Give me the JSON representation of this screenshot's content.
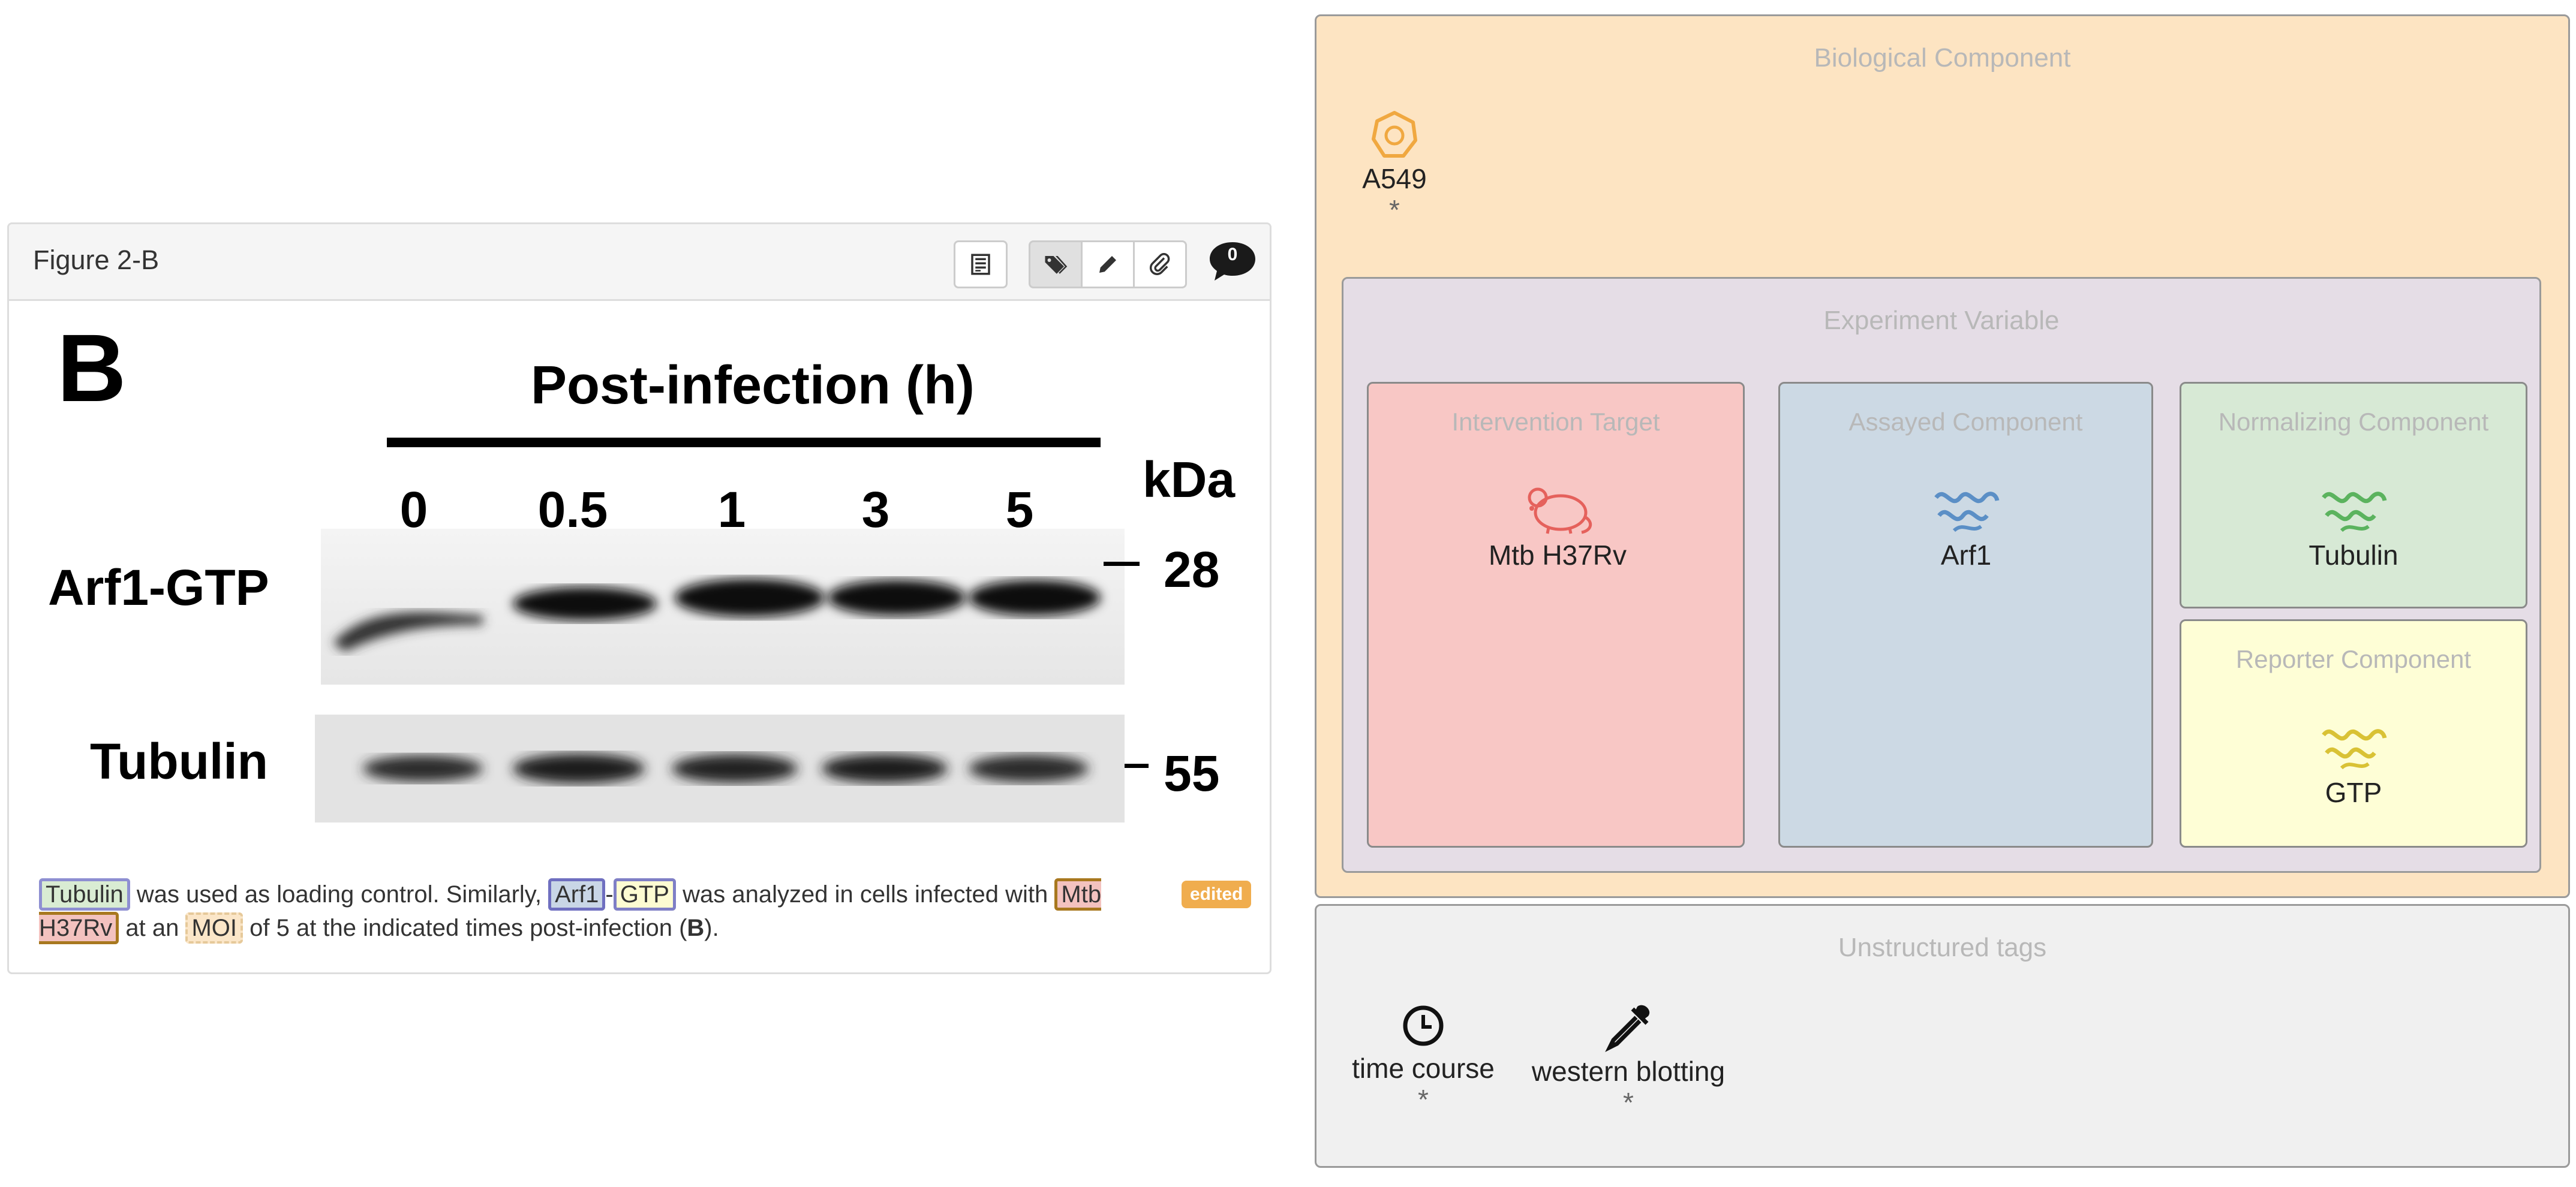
{
  "figure": {
    "title": "Figure 2-B",
    "comment_count": "0",
    "edited_label": "edited",
    "blot": {
      "panel_letter": "B",
      "axis_title": "Post-infection (h)",
      "time_points": [
        "0",
        "0.5",
        "1",
        "3",
        "5"
      ],
      "unit_label": "kDa",
      "rows": [
        {
          "label": "Arf1-GTP",
          "mw": "28"
        },
        {
          "label": "Tubulin",
          "mw": "55"
        }
      ]
    },
    "caption": {
      "tag_tubulin": "Tubulin",
      "t1": " was used as loading control. Similarly, ",
      "tag_arf1": "Arf1",
      "dash": "-",
      "tag_gtp": "GTP",
      "t2": " was analyzed in cells infected with ",
      "tag_mtb": "Mtb H37Rv",
      "t3": " at an ",
      "tag_moi": "MOI",
      "t4": " of 5 at the indicated times post-infection (",
      "bold_b": "B",
      "t5": ")."
    }
  },
  "biological_component": {
    "title": "Biological Component",
    "entity": {
      "label": "A549",
      "icon": "cell-icon",
      "marker": "*"
    }
  },
  "experiment_variable": {
    "title": "Experiment Variable",
    "intervention_target": {
      "title": "Intervention Target",
      "entity": "Mtb H37Rv",
      "icon": "mouse-icon",
      "color": "#e5615c"
    },
    "assayed_component": {
      "title": "Assayed Component",
      "entity": "Arf1",
      "icon": "protein-icon",
      "color": "#5b8fc6"
    },
    "normalizing_component": {
      "title": "Normalizing Component",
      "entity": "Tubulin",
      "icon": "protein-icon",
      "color": "#5bb35e"
    },
    "reporter_component": {
      "title": "Reporter Component",
      "entity": "GTP",
      "icon": "protein-icon",
      "color": "#d9c235"
    }
  },
  "unstructured_tags": {
    "title": "Unstructured tags",
    "items": [
      {
        "label": "time course",
        "icon": "clock-icon",
        "marker": "*"
      },
      {
        "label": "western blotting",
        "icon": "pipette-icon",
        "marker": "*"
      }
    ]
  }
}
